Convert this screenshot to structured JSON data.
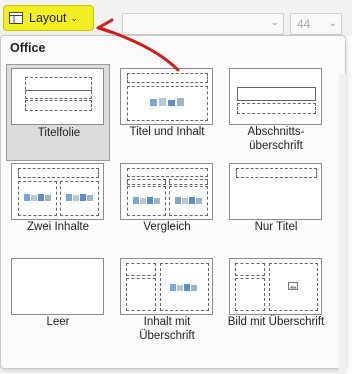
{
  "toolbar": {
    "layout_label": "Layout",
    "font_size_value": "44"
  },
  "gallery": {
    "section_title": "Office",
    "layouts": [
      {
        "label": "Titelfolie"
      },
      {
        "label": "Titel und Inhalt"
      },
      {
        "label": "Abschnitts-überschrift"
      },
      {
        "label": "Zwei Inhalte"
      },
      {
        "label": "Vergleich"
      },
      {
        "label": "Nur Titel"
      },
      {
        "label": "Leer"
      },
      {
        "label": "Inhalt mit Überschrift"
      },
      {
        "label": "Bild mit Überschrift"
      }
    ]
  },
  "annotation": {
    "arrow_color": "#d71a1a"
  }
}
